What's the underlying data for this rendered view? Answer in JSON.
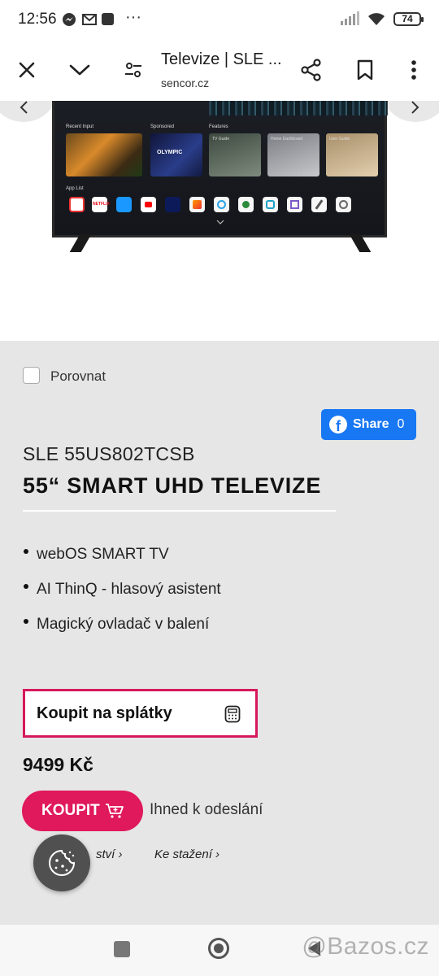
{
  "status_bar": {
    "time": "12:56",
    "battery": "74",
    "more": "···"
  },
  "browser": {
    "title": "Televize | SLE ...",
    "url": "sencor.cz"
  },
  "tv_screen": {
    "recent_input": "Recent Input",
    "sponsored": "Sponsored",
    "features": "Features",
    "app_list": "App List",
    "card_tv_guide": "TV Guide",
    "card_home_dashboard": "Home Dashboard",
    "card_user_guide": "User Guide"
  },
  "product": {
    "compare_label": "Porovnat",
    "share_label": "Share",
    "share_count": "0",
    "model": "SLE 55US802TCSB",
    "headline": "55“ SMART UHD TELEVIZE",
    "features": [
      "webOS SMART TV",
      "AI ThinQ - hlasový asistent",
      "Magický ovladač v balení"
    ],
    "installment_button": "Koupit na splátky",
    "price": "9499 Kč",
    "buy_button": "KOUPIT",
    "stock_status": "Ihned k odeslání",
    "link_params": "ství",
    "link_downloads": "Ke stažení"
  },
  "watermark": "@Bazos.cz",
  "colors": {
    "brand_red": "#e0185c",
    "facebook_blue": "#1877f2",
    "product_bg": "#e6e6e6"
  },
  "icons": [
    "close-icon",
    "chevron-down-icon",
    "tune-icon",
    "share-icon",
    "bookmark-icon",
    "more-vert-icon",
    "chevron-left-icon",
    "chevron-right-icon",
    "facebook-icon",
    "calculator-icon",
    "cart-icon",
    "cookie-icon"
  ]
}
